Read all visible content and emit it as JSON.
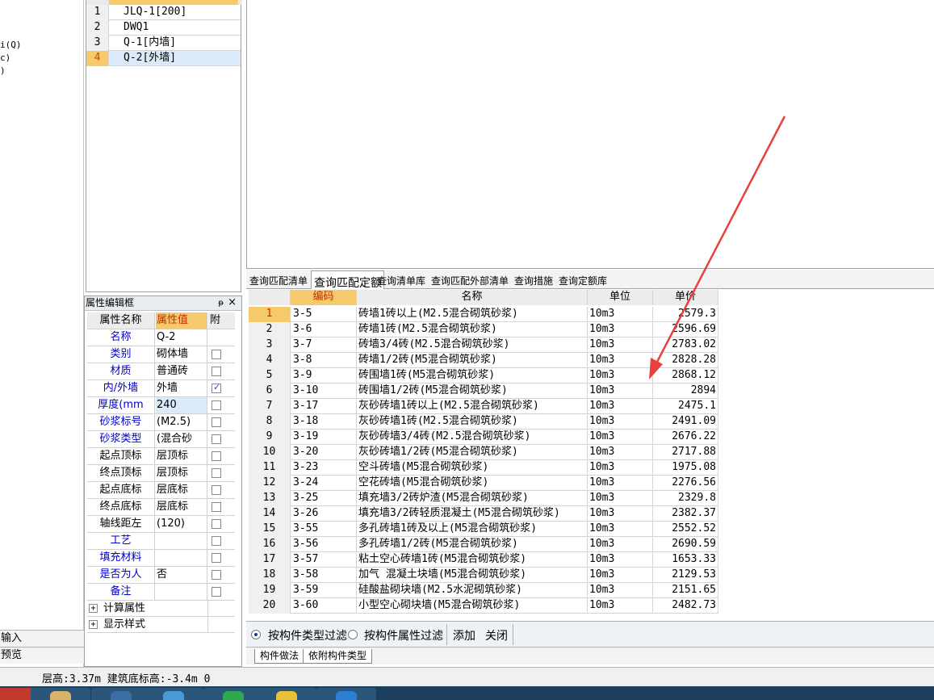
{
  "left_strip": {
    "fragments": [
      "i(Q)",
      "c)",
      ")"
    ],
    "rows": [
      "输入",
      "预览"
    ]
  },
  "component_list": {
    "items": [
      {
        "num": "1",
        "name": "JLQ-1[200]"
      },
      {
        "num": "2",
        "name": "DWQ1"
      },
      {
        "num": "3",
        "name": "Q-1[内墙]"
      },
      {
        "num": "4",
        "name": "Q-2[外墙]",
        "selected": true
      }
    ]
  },
  "property_panel": {
    "title": "属性编辑框",
    "pin_label": "ᵽ",
    "close_label": "×",
    "headers": {
      "name": "属性名称",
      "value": "属性值",
      "attach": "附"
    },
    "rows": [
      {
        "name": "名称",
        "value": "Q-2",
        "blue": true,
        "check": null
      },
      {
        "name": "类别",
        "value": "砌体墙",
        "blue": true,
        "check": false
      },
      {
        "name": "材质",
        "value": "普通砖",
        "blue": true,
        "check": false
      },
      {
        "name": "内/外墙",
        "value": "外墙",
        "blue": true,
        "check": true
      },
      {
        "name": "厚度(mm",
        "value": "240",
        "blue": true,
        "check": false,
        "highlight": true
      },
      {
        "name": "砂浆标号",
        "value": "(M2.5)",
        "blue": true,
        "check": false
      },
      {
        "name": "砂浆类型",
        "value": "(混合砂",
        "blue": true,
        "check": false
      },
      {
        "name": "起点顶标",
        "value": "层顶标",
        "blue": false,
        "check": false
      },
      {
        "name": "终点顶标",
        "value": "层顶标",
        "blue": false,
        "check": false
      },
      {
        "name": "起点底标",
        "value": "层底标",
        "blue": false,
        "check": false
      },
      {
        "name": "终点底标",
        "value": "层底标",
        "blue": false,
        "check": false
      },
      {
        "name": "轴线距左",
        "value": "(120)",
        "blue": false,
        "check": false
      },
      {
        "name": "工艺",
        "value": "",
        "blue": true,
        "check": false
      },
      {
        "name": "填充材料",
        "value": "",
        "blue": true,
        "check": false
      },
      {
        "name": "是否为人",
        "value": "否",
        "blue": true,
        "check": false
      },
      {
        "name": "备注",
        "value": "",
        "blue": true,
        "check": false
      }
    ],
    "groups": [
      {
        "expander": "+",
        "label": "计算属性"
      },
      {
        "expander": "+",
        "label": "显示样式"
      }
    ]
  },
  "query_tabs": [
    {
      "label": "查询匹配清单",
      "active": false
    },
    {
      "label": "查询匹配定额",
      "active": true
    },
    {
      "label": "查询清单库",
      "active": false
    },
    {
      "label": "查询匹配外部清单",
      "active": false
    },
    {
      "label": "查询措施",
      "active": false
    },
    {
      "label": "查询定额库",
      "active": false
    }
  ],
  "quota_table": {
    "headers": {
      "code": "编码",
      "name": "名称",
      "unit": "单位",
      "price": "单价"
    },
    "rows": [
      {
        "idx": "1",
        "code": "3-5",
        "name": "砖墙1砖以上(M2.5混合砌筑砂浆)",
        "unit": "10m3",
        "price": "2579.3"
      },
      {
        "idx": "2",
        "code": "3-6",
        "name": "砖墙1砖(M2.5混合砌筑砂浆)",
        "unit": "10m3",
        "price": "2596.69"
      },
      {
        "idx": "3",
        "code": "3-7",
        "name": "砖墙3/4砖(M2.5混合砌筑砂浆)",
        "unit": "10m3",
        "price": "2783.02"
      },
      {
        "idx": "4",
        "code": "3-8",
        "name": "砖墙1/2砖(M5混合砌筑砂浆)",
        "unit": "10m3",
        "price": "2828.28"
      },
      {
        "idx": "5",
        "code": "3-9",
        "name": "砖围墙1砖(M5混合砌筑砂浆)",
        "unit": "10m3",
        "price": "2868.12"
      },
      {
        "idx": "6",
        "code": "3-10",
        "name": "砖围墙1/2砖(M5混合砌筑砂浆)",
        "unit": "10m3",
        "price": "2894"
      },
      {
        "idx": "7",
        "code": "3-17",
        "name": "灰砂砖墙1砖以上(M2.5混合砌筑砂浆)",
        "unit": "10m3",
        "price": "2475.1"
      },
      {
        "idx": "8",
        "code": "3-18",
        "name": "灰砂砖墙1砖(M2.5混合砌筑砂浆)",
        "unit": "10m3",
        "price": "2491.09"
      },
      {
        "idx": "9",
        "code": "3-19",
        "name": "灰砂砖墙3/4砖(M2.5混合砌筑砂浆)",
        "unit": "10m3",
        "price": "2676.22"
      },
      {
        "idx": "10",
        "code": "3-20",
        "name": "灰砂砖墙1/2砖(M5混合砌筑砂浆)",
        "unit": "10m3",
        "price": "2717.88"
      },
      {
        "idx": "11",
        "code": "3-23",
        "name": "空斗砖墙(M5混合砌筑砂浆)",
        "unit": "10m3",
        "price": "1975.08"
      },
      {
        "idx": "12",
        "code": "3-24",
        "name": "空花砖墙(M5混合砌筑砂浆)",
        "unit": "10m3",
        "price": "2276.56"
      },
      {
        "idx": "13",
        "code": "3-25",
        "name": "填充墙3/2砖炉渣(M5混合砌筑砂浆)",
        "unit": "10m3",
        "price": "2329.8"
      },
      {
        "idx": "14",
        "code": "3-26",
        "name": "填充墙3/2砖轻质混凝土(M5混合砌筑砂浆)",
        "unit": "10m3",
        "price": "2382.37"
      },
      {
        "idx": "15",
        "code": "3-55",
        "name": "多孔砖墙1砖及以上(M5混合砌筑砂浆)",
        "unit": "10m3",
        "price": "2552.52"
      },
      {
        "idx": "16",
        "code": "3-56",
        "name": "多孔砖墙1/2砖(M5混合砌筑砂浆)",
        "unit": "10m3",
        "price": "2690.59"
      },
      {
        "idx": "17",
        "code": "3-57",
        "name": "粘土空心砖墙1砖(M5混合砌筑砂浆)",
        "unit": "10m3",
        "price": "1653.33"
      },
      {
        "idx": "18",
        "code": "3-58",
        "name": "加气 混凝土块墙(M5混合砌筑砂浆)",
        "unit": "10m3",
        "price": "2129.53"
      },
      {
        "idx": "19",
        "code": "3-59",
        "name": "硅酸盐砌块墙(M2.5水泥砌筑砂浆)",
        "unit": "10m3",
        "price": "2151.65"
      },
      {
        "idx": "20",
        "code": "3-60",
        "name": "小型空心砌块墙(M5混合砌筑砂浆)",
        "unit": "10m3",
        "price": "2482.73"
      }
    ]
  },
  "filter_bar": {
    "radio1": "按构件类型过滤",
    "radio2": "按构件属性过滤",
    "add": "添加",
    "close": "关闭"
  },
  "sheet_tabs": [
    "构件做法",
    "依附构件类型"
  ],
  "status_bar": {
    "text": "层高:3.37m 建筑底标高:-3.4m 0"
  },
  "colors": {
    "header_orange": "#f7c96d",
    "selection_blue": "#dbeaf8",
    "property_blue": "#0000c8",
    "annotation_arrow": "#e8403a",
    "taskbar": "#1c3f5e"
  }
}
